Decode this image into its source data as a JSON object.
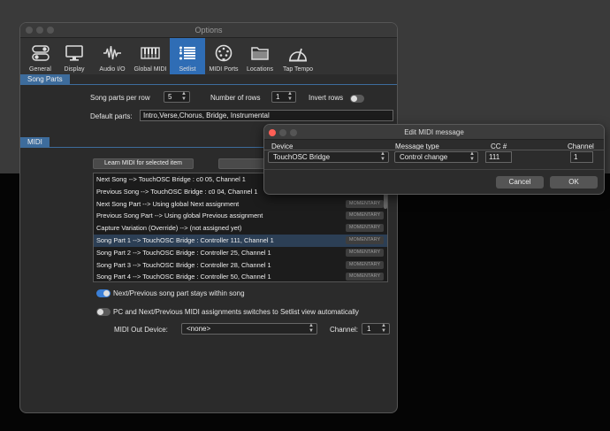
{
  "window": {
    "title": "Options"
  },
  "toolbar": {
    "items": [
      {
        "label": "General",
        "icon": "toggles-icon"
      },
      {
        "label": "Display",
        "icon": "monitor-icon"
      },
      {
        "label": "Audio I/O",
        "icon": "waveform-icon"
      },
      {
        "label": "Global MIDI",
        "icon": "keyboard-icon"
      },
      {
        "label": "Setlist",
        "icon": "list-icon",
        "active": true
      },
      {
        "label": "MIDI Ports",
        "icon": "midi-port-icon"
      },
      {
        "label": "Locations",
        "icon": "folder-icon"
      },
      {
        "label": "Tap Tempo",
        "icon": "metronome-icon"
      }
    ]
  },
  "song_parts": {
    "section_label": "Song Parts",
    "per_row_label": "Song parts per row",
    "per_row_value": "5",
    "rows_label": "Number of rows",
    "rows_value": "1",
    "invert_label": "Invert rows",
    "invert_on": false,
    "default_parts_label": "Default parts:",
    "default_parts_value": "Intro,Verse,Chorus, Bridge, Instrumental"
  },
  "midi": {
    "section_label": "MIDI",
    "learn_button": "Learn MIDI for selected item",
    "items": [
      {
        "text": "Next Song --> TouchOSC Bridge : c0 05, Channel 1",
        "badge": ""
      },
      {
        "text": "Previous Song --> TouchOSC Bridge : c0 04, Channel 1",
        "badge": ""
      },
      {
        "text": "Next Song Part --> Using global Next assignment",
        "badge": "MOMENTARY"
      },
      {
        "text": "Previous Song Part --> Using global Previous assignment",
        "badge": "MOMENTARY"
      },
      {
        "text": "Capture Variation (Override) --> (not assigned yet)",
        "badge": "MOMENTARY"
      },
      {
        "text": "Song Part 1 --> TouchOSC Bridge : Controller 111, Channel 1",
        "badge": "MOMENTARY",
        "selected": true
      },
      {
        "text": "Song Part 2 --> TouchOSC Bridge : Controller 25, Channel 1",
        "badge": "MOMENTARY"
      },
      {
        "text": "Song Part 3 --> TouchOSC Bridge : Controller 28, Channel 1",
        "badge": "MOMENTARY"
      },
      {
        "text": "Song Part 4 --> TouchOSC Bridge : Controller 50, Channel 1",
        "badge": "MOMENTARY"
      }
    ],
    "stay_within_label": "Next/Previous song part stays within song",
    "stay_within_on": true,
    "switch_view_label": "PC and Next/Previous MIDI assignments switches to Setlist view automatically",
    "switch_view_on": false,
    "out_device_label": "MIDI Out Device:",
    "out_device_value": "<none>",
    "channel_label": "Channel:",
    "channel_value": "1"
  },
  "dialog": {
    "title": "Edit MIDI message",
    "device_header": "Device",
    "device_value": "TouchOSC Bridge",
    "msg_type_header": "Message type",
    "msg_type_value": "Control change",
    "cc_header": "CC #",
    "cc_value": "111",
    "channel_header": "Channel",
    "channel_value": "1",
    "cancel_label": "Cancel",
    "ok_label": "OK"
  },
  "colors": {
    "accent": "#2f6db5",
    "section": "#3d6c9c",
    "close": "#ff5f56"
  }
}
